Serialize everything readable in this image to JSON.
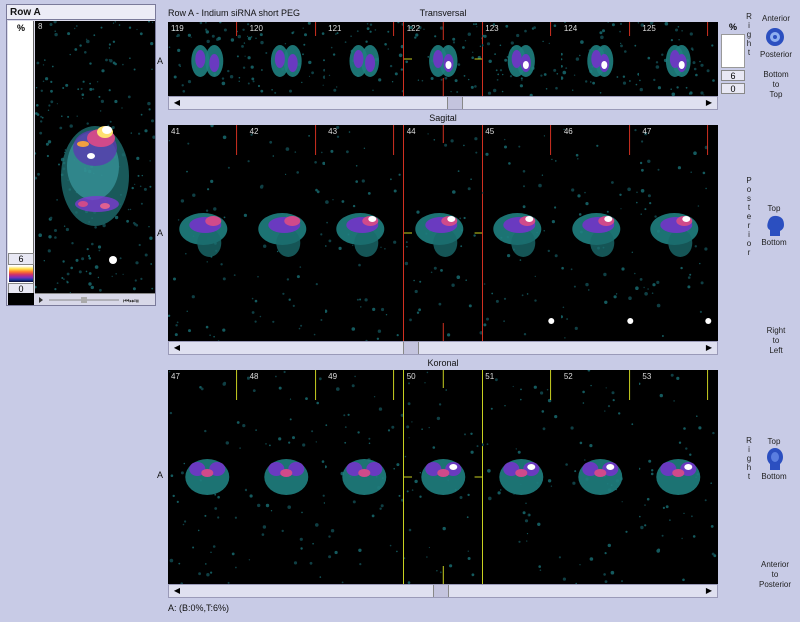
{
  "left_panel": {
    "title": "Row A",
    "scale_label": "%",
    "scale_max": "6",
    "scale_min": "0",
    "frame_number": "8"
  },
  "header": {
    "row_label": "Row A - Indium   siRNA   short PEG"
  },
  "sections": {
    "transversal": {
      "title": "Transversal",
      "frames": [
        "119",
        "120",
        "121",
        "122",
        "123",
        "124",
        "125"
      ]
    },
    "sagital": {
      "title": "Sagital",
      "frames": [
        "41",
        "42",
        "43",
        "44",
        "45",
        "46",
        "47"
      ]
    },
    "koronal": {
      "title": "Koronal",
      "frames": [
        "47",
        "48",
        "49",
        "50",
        "51",
        "52",
        "53"
      ]
    }
  },
  "axis_letter": "A",
  "right_panel": {
    "scale_label": "%",
    "scale_max": "6",
    "scale_min": "0",
    "right_vertical": "Right",
    "anterior": "Anterior",
    "posterior": "Posterior",
    "bottom_to_top": [
      "Bottom",
      "to",
      "Top"
    ],
    "posterior_vertical": "Posterior",
    "top": "Top",
    "bottom": "Bottom",
    "right_to_left": [
      "Right",
      "to",
      "Left"
    ],
    "right_vertical_2": "Right",
    "top_2": "Top",
    "bottom_2": "Bottom",
    "anterior_to_posterior": [
      "Anterior",
      "to",
      "Posterior"
    ]
  },
  "status_text": "A: (B:0%,T:6%)",
  "colors": {
    "background": "#c8cbe6",
    "image_bg": "#000000",
    "hot": "#ffffff",
    "mid": "#9a3ad0",
    "low": "#2fa8a0",
    "crosshair_red": "#d03020",
    "crosshair_yellow": "#c8d020"
  }
}
